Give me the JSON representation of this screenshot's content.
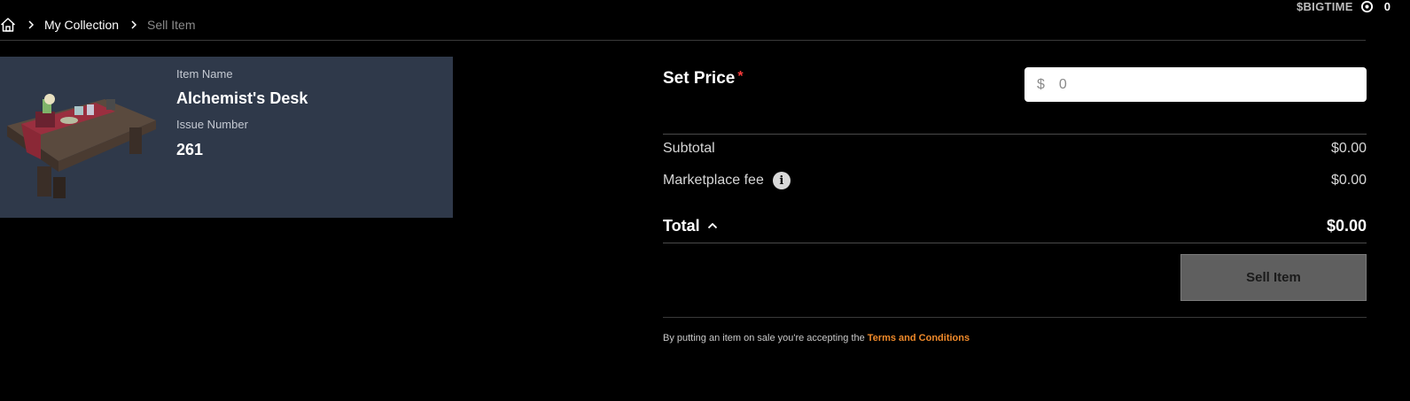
{
  "header": {
    "currency_label": "$BIGTIME",
    "currency_value": "0"
  },
  "breadcrumb": {
    "items": [
      {
        "label": "My Collection"
      },
      {
        "label": "Sell Item"
      }
    ]
  },
  "item": {
    "name_label": "Item Name",
    "name": "Alchemist's Desk",
    "issue_label": "Issue Number",
    "issue_number": "261"
  },
  "pricing": {
    "set_price_label": "Set Price",
    "required_mark": "*",
    "currency_symbol": "$",
    "price_placeholder": "0",
    "subtotal_label": "Subtotal",
    "subtotal_value": "$0.00",
    "fee_label": "Marketplace fee",
    "fee_value": "$0.00",
    "total_label": "Total",
    "total_value": "$0.00",
    "sell_button": "Sell Item"
  },
  "terms": {
    "text": "By putting an item on sale you're accepting the ",
    "link": "Terms and Conditions"
  },
  "icons": {
    "home": "home-icon",
    "breadcrumb_separator": "chevron-right-icon",
    "currency": "bigtime-token-icon",
    "info": "info-icon",
    "total_toggle": "chevron-up-icon"
  },
  "colors": {
    "background": "#000000",
    "card": "#2f394a",
    "required": "#ff3b3b",
    "link": "#f08a2a",
    "button_disabled": "#5f5f5f"
  }
}
